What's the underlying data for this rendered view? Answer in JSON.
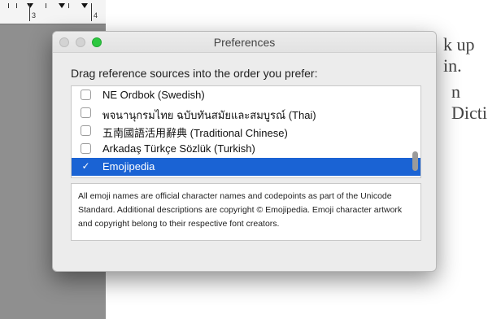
{
  "background": {
    "ruler_numbers": [
      "3",
      "4"
    ],
    "doc_lines": [
      "k up in.",
      "n Dicti"
    ]
  },
  "window": {
    "title": "Preferences",
    "instruction": "Drag reference sources into the order you prefer:"
  },
  "sources": [
    {
      "label": "NE Ordbok (Swedish)",
      "checked": false,
      "selected": false
    },
    {
      "label": "พจนานุกรมไทย ฉบับทันสมัยและสมบูรณ์ (Thai)",
      "checked": false,
      "selected": false
    },
    {
      "label": "五南國語活用辭典 (Traditional Chinese)",
      "checked": false,
      "selected": false
    },
    {
      "label": "Arkadaş Türkçe Sözlük (Turkish)",
      "checked": false,
      "selected": false
    },
    {
      "label": "Emojipedia",
      "checked": true,
      "selected": true,
      "checkmark": "✓"
    }
  ],
  "description": "All emoji names are official character names and codepoints as part of the Unicode Standard. Additional descriptions are copyright © Emojipedia. Emoji character artwork and copyright belong to their respective font creators.",
  "colors": {
    "selection": "#1a63d4",
    "zoom_button": "#2dc840"
  }
}
